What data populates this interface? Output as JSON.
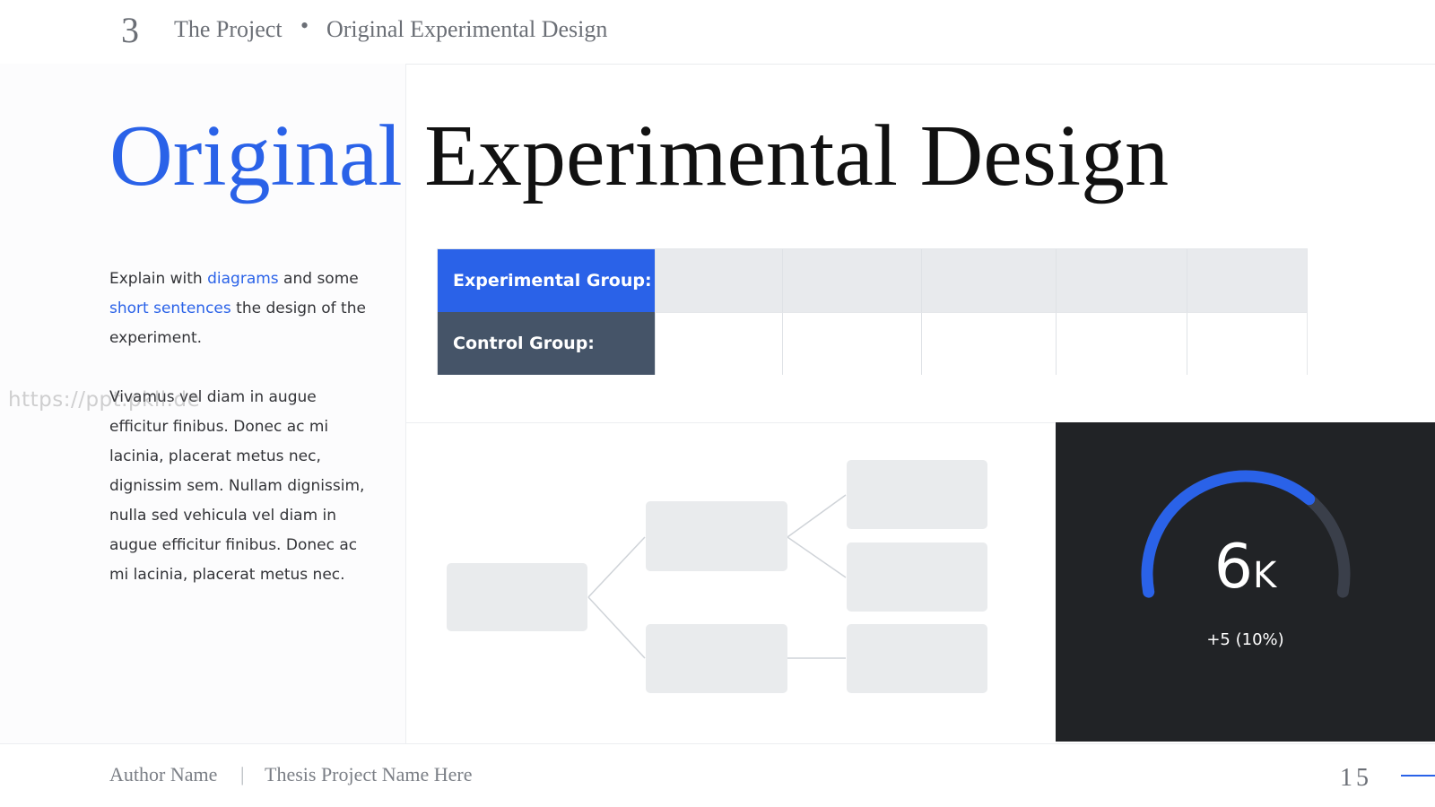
{
  "header": {
    "section_number": "3",
    "section_title": "The Project",
    "separator": "•",
    "subsection_title": "Original Experimental Design"
  },
  "title": {
    "highlight": "Original",
    "rest": "Experimental Design"
  },
  "description": {
    "p1_part1": "Explain with ",
    "p1_highlight1": "diagrams",
    "p1_part2": " and some ",
    "p1_highlight2": "short sentences",
    "p1_part3": " the design of the experiment.",
    "p2": "Vivamus vel diam in augue efficitur finibus. Donec ac mi lacinia, placerat metus nec, dignissim sem. Nullam dignissim, nulla sed vehicula vel diam in augue efficitur finibus. Donec ac mi lacinia, placerat metus nec."
  },
  "watermark": "https://ppt.pkll.de",
  "table": {
    "rows": [
      {
        "label": "Experimental Group:"
      },
      {
        "label": "Control Group:"
      }
    ]
  },
  "gauge": {
    "value": "6",
    "unit": "K",
    "delta": "+5 (10%)",
    "fill_fraction": 0.7,
    "track_color": "#3a3f4a",
    "fill_color": "#2a62e8"
  },
  "footer": {
    "author": "Author Name",
    "separator": "|",
    "project": "Thesis Project Name Here",
    "page_number": "15"
  },
  "colors": {
    "accent": "#2a62e8",
    "dark_label": "#455468",
    "panel_dark": "#212326"
  }
}
